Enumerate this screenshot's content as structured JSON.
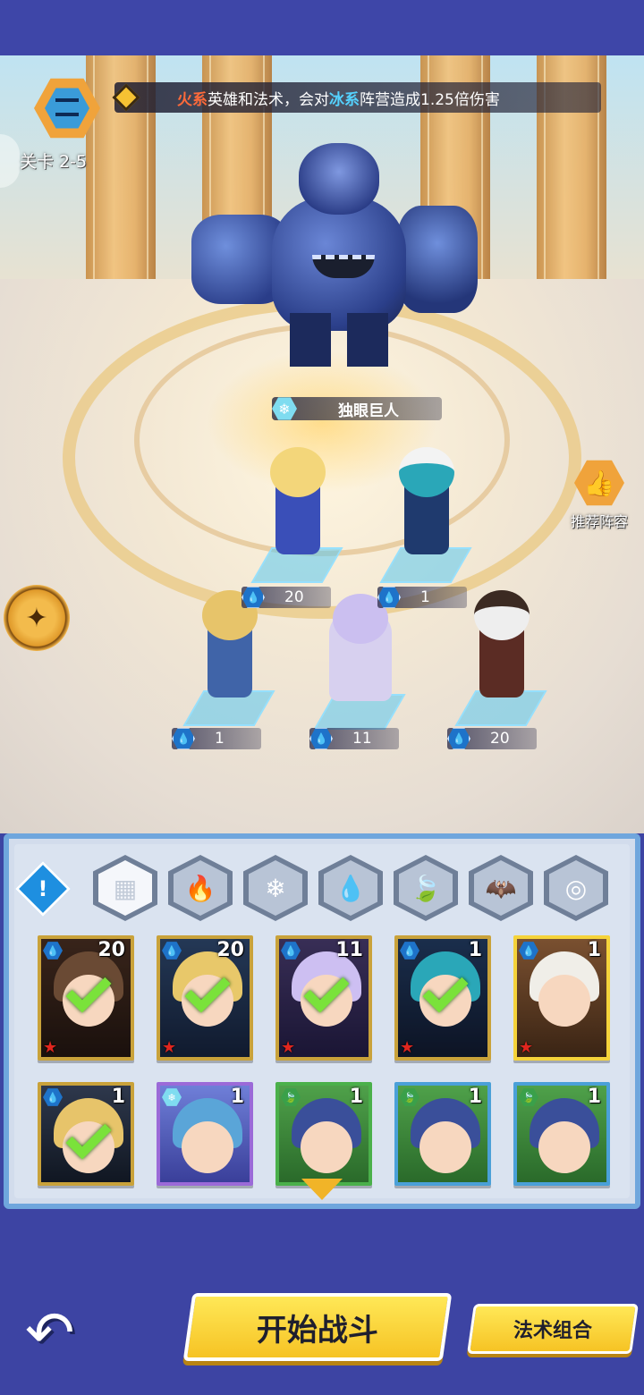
{
  "header": {
    "level_label": "关卡 2-5",
    "banner": {
      "part1": "火系",
      "part2": "英雄和法术，会对",
      "part3": "冰系",
      "part4": "阵营造成1.25倍伤害"
    }
  },
  "boss": {
    "name": "独眼巨人",
    "element_icon": "snowflake-icon"
  },
  "recommend_label": "推荐阵容",
  "lineup": [
    {
      "level": "20",
      "element": "water"
    },
    {
      "level": "1",
      "element": "water"
    },
    {
      "level": "1",
      "element": "water"
    },
    {
      "level": "11",
      "element": "water"
    },
    {
      "level": "20",
      "element": "water"
    }
  ],
  "filters": [
    "all-grid-icon",
    "fire-icon",
    "ice-icon",
    "water-icon",
    "leaf-icon",
    "mask-icon",
    "vortex-icon"
  ],
  "hint_symbol": "!",
  "roster": [
    {
      "count": "20",
      "element": "water",
      "selected": true
    },
    {
      "count": "20",
      "element": "water",
      "selected": true
    },
    {
      "count": "11",
      "element": "water",
      "selected": true
    },
    {
      "count": "1",
      "element": "water",
      "selected": true
    },
    {
      "count": "1",
      "element": "water",
      "selected": false
    },
    {
      "count": "1",
      "element": "water",
      "selected": true
    },
    {
      "count": "1",
      "element": "ice",
      "selected": false
    },
    {
      "count": "1",
      "element": "nature",
      "selected": false
    },
    {
      "count": "1",
      "element": "nature",
      "selected": false
    },
    {
      "count": "1",
      "element": "nature",
      "selected": false
    }
  ],
  "buttons": {
    "start": "开始战斗",
    "spells": "法术组合",
    "back_symbol": "↶"
  },
  "colors": {
    "fire": "#ff6a3a",
    "ice": "#55d2ff",
    "water": "#1e73c9",
    "nature": "#3aa04a",
    "button": "#f6c324",
    "panel_border": "#6fa6dd"
  }
}
